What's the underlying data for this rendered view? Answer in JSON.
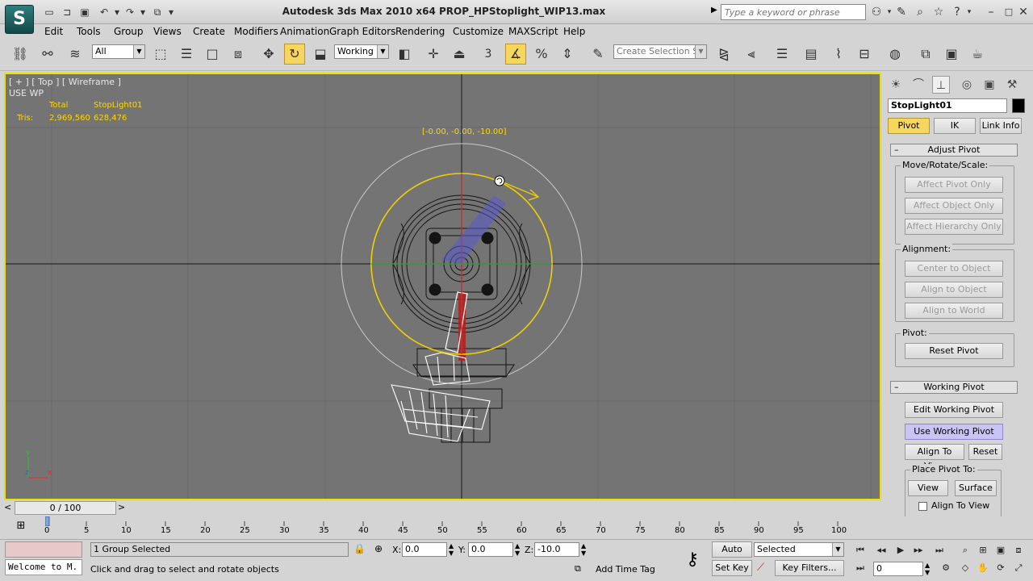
{
  "app": {
    "logo": "3ds-max-logo",
    "title": "Autodesk 3ds Max  2010 x64     PROP_HPStoplight_WIP13.max",
    "search_placeholder": "Type a keyword or phrase"
  },
  "menu": [
    "Edit",
    "Tools",
    "Group",
    "Views",
    "Create",
    "Modifiers",
    "Animation",
    "Graph Editors",
    "Rendering",
    "Customize",
    "MAXScript",
    "Help"
  ],
  "toolbar": {
    "selection_filter": "All",
    "coord_system": "Working",
    "named_selection_placeholder": "Create Selection Se",
    "snap_label": "3"
  },
  "viewport": {
    "label": "[ + ] [ Top ] [ Wireframe ]",
    "mode": "USE WP",
    "stats": {
      "col_total": "Total",
      "col_object": "StopLight01",
      "row_label": "Tris:",
      "total_tris": "2,969,560",
      "object_tris": "628,476"
    },
    "gizmo_readout": "[-0.00, -0.00, -10.00]",
    "axis_y": "y",
    "axis_x": "x",
    "axis_z": "z"
  },
  "command_panel": {
    "object_name": "StopLight01",
    "object_color": "#000000",
    "tabs": {
      "pivot": "Pivot",
      "ik": "IK",
      "link_info": "Link Info"
    },
    "adjust_pivot": {
      "title": "Adjust Pivot",
      "group_move": "Move/Rotate/Scale:",
      "affect_pivot": "Affect Pivot Only",
      "affect_object": "Affect Object Only",
      "affect_hierarchy": "Affect Hierarchy Only",
      "group_alignment": "Alignment:",
      "center_to_object": "Center to Object",
      "align_to_object": "Align to Object",
      "align_to_world": "Align to World",
      "group_pivot": "Pivot:",
      "reset_pivot": "Reset Pivot"
    },
    "working_pivot": {
      "title": "Working Pivot",
      "edit": "Edit Working Pivot",
      "use": "Use Working Pivot",
      "align_to_view": "Align To View",
      "reset": "Reset",
      "place_label": "Place Pivot To:",
      "view": "View",
      "surface": "Surface",
      "align_checkbox": "Align To View"
    }
  },
  "timeline": {
    "frame_counter": "0 / 100",
    "ticks": [
      "0",
      "5",
      "10",
      "15",
      "20",
      "25",
      "30",
      "35",
      "40",
      "45",
      "50",
      "55",
      "60",
      "65",
      "70",
      "75",
      "80",
      "85",
      "90",
      "95",
      "100"
    ]
  },
  "status": {
    "maxscript_listener": "Welcome to M.",
    "selection": "1 Group Selected",
    "prompt": "Click and drag to select and rotate objects",
    "x_label": "X:",
    "x_value": "0.0",
    "y_label": "Y:",
    "y_value": "0.0",
    "z_label": "Z:",
    "z_value": "-10.0",
    "add_time_tag": "Add Time Tag",
    "auto_key": "Auto Key",
    "set_key": "Set Key",
    "key_mode": "Selected",
    "key_filters": "Key Filters...",
    "current_frame": "0"
  }
}
